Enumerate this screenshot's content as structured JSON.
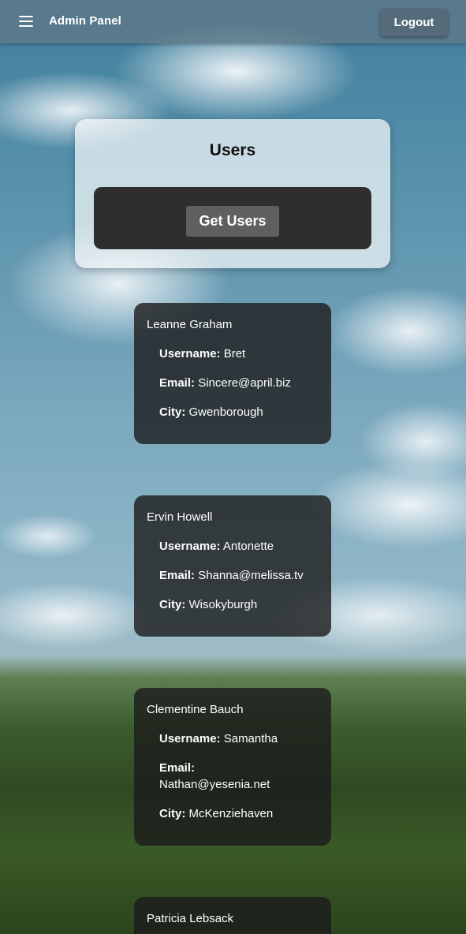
{
  "header": {
    "title": "Admin Panel",
    "logout_label": "Logout"
  },
  "users_panel": {
    "heading": "Users",
    "get_users_label": "Get Users"
  },
  "field_labels": {
    "username": "Username:",
    "email": "Email:",
    "city": "City:"
  },
  "users": [
    {
      "name": "Leanne Graham",
      "username": "Bret",
      "email": "Sincere@april.biz",
      "city": "Gwenborough"
    },
    {
      "name": "Ervin Howell",
      "username": "Antonette",
      "email": "Shanna@melissa.tv",
      "city": "Wisokyburgh"
    },
    {
      "name": "Clementine Bauch",
      "username": "Samantha",
      "email": "Nathan@yesenia.net",
      "city": "McKenziehaven"
    },
    {
      "name": "Patricia Lebsack"
    }
  ],
  "icons": {
    "menu": "hamburger-menu-icon"
  }
}
